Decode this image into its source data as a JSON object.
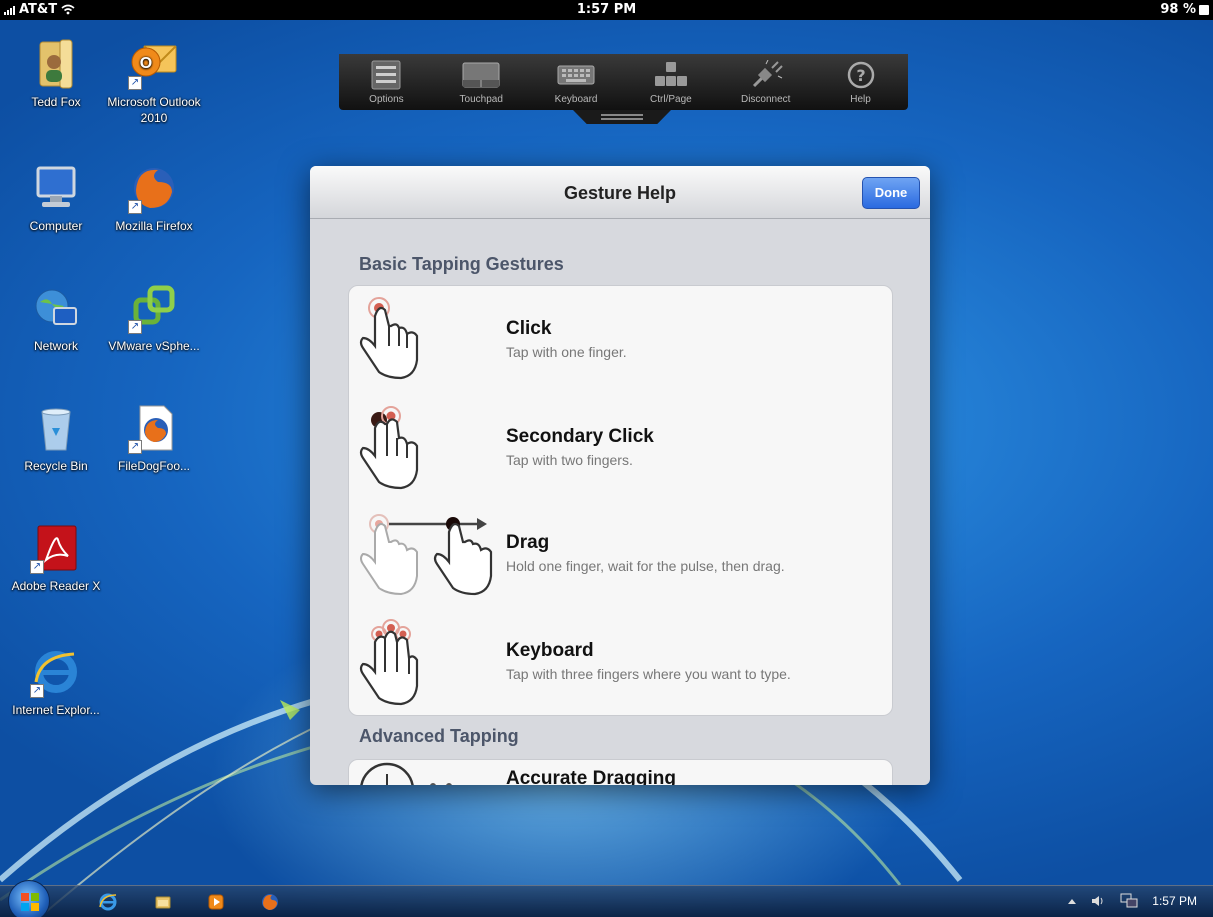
{
  "status_bar": {
    "carrier": "AT&T",
    "time": "1:57 PM",
    "battery": "98 %"
  },
  "desktop_icons": [
    {
      "label": "Tedd Fox",
      "icon": "user-folder-icon"
    },
    {
      "label": "Microsoft Outlook 2010",
      "icon": "outlook-icon"
    },
    {
      "label": "Computer",
      "icon": "computer-icon"
    },
    {
      "label": "Mozilla Firefox",
      "icon": "firefox-icon"
    },
    {
      "label": "Network",
      "icon": "network-icon"
    },
    {
      "label": "VMware vSphe...",
      "icon": "vmware-icon"
    },
    {
      "label": "Recycle Bin",
      "icon": "recycle-bin-icon"
    },
    {
      "label": "FileDogFoo...",
      "icon": "firefox-document-icon"
    },
    {
      "label": "Adobe Reader X",
      "icon": "adobe-reader-icon"
    },
    {
      "label": "Internet Explor...",
      "icon": "internet-explorer-icon"
    }
  ],
  "toolbar": {
    "items": [
      {
        "label": "Options",
        "icon": "list-icon"
      },
      {
        "label": "Touchpad",
        "icon": "touchpad-icon"
      },
      {
        "label": "Keyboard",
        "icon": "keyboard-icon"
      },
      {
        "label": "Ctrl/Page",
        "icon": "ctrl-page-icon"
      },
      {
        "label": "Disconnect",
        "icon": "disconnect-plug-icon"
      },
      {
        "label": "Help",
        "icon": "help-icon"
      }
    ]
  },
  "modal": {
    "title": "Gesture Help",
    "done_label": "Done",
    "section_basic": "Basic Tapping Gestures",
    "gestures": [
      {
        "title": "Click",
        "description": "Tap with one finger."
      },
      {
        "title": "Secondary Click",
        "description": "Tap with two fingers."
      },
      {
        "title": "Drag",
        "description": "Hold one finger, wait for the pulse, then drag."
      },
      {
        "title": "Keyboard",
        "description": "Tap with three fingers where you want to type."
      }
    ],
    "section_advanced": "Advanced Tapping",
    "advanced_gestures": [
      {
        "title": "Accurate Dragging"
      }
    ]
  },
  "taskbar": {
    "pinned": [
      "internet-explorer-icon",
      "explorer-folder-icon",
      "media-player-icon",
      "firefox-icon"
    ],
    "clock": "1:57 PM"
  },
  "colors": {
    "done_button": "#2a6ae0",
    "desktop_blue": "#1a6fc7",
    "modal_background": "#d7d9de"
  }
}
